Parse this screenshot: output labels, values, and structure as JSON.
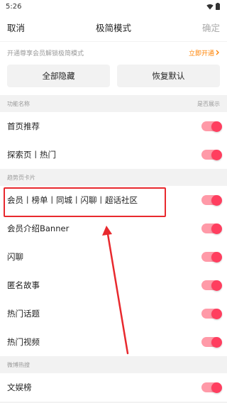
{
  "status_bar": {
    "time": "5:26"
  },
  "nav": {
    "cancel": "取消",
    "title": "极简模式",
    "confirm": "确定"
  },
  "promo": {
    "text": "开通尊享会员解锁极简模式",
    "link": "立即开通"
  },
  "buttons": {
    "hide_all": "全部隐藏",
    "restore": "恢复默认"
  },
  "sections": [
    {
      "title": "功能名称",
      "right": "是否展示",
      "rows": [
        {
          "label": "首页推荐",
          "on": true
        },
        {
          "label": "探索页丨热门",
          "on": true
        }
      ]
    },
    {
      "title": "趋势页卡片",
      "right": "",
      "rows": [
        {
          "label": "会员丨榜单丨同城丨闪聊丨超话社区",
          "on": true
        },
        {
          "label": "会员介绍Banner",
          "on": true
        },
        {
          "label": "闪聊",
          "on": true
        },
        {
          "label": "匿名故事",
          "on": true
        },
        {
          "label": "热门话题",
          "on": true
        },
        {
          "label": "热门视频",
          "on": true
        }
      ]
    },
    {
      "title": "微博热搜",
      "right": "",
      "rows": [
        {
          "label": "文娱榜",
          "on": true
        }
      ]
    }
  ],
  "colors": {
    "accent": "#ff3e5f",
    "promo": "#ff8200",
    "annotation": "#e8292e"
  }
}
